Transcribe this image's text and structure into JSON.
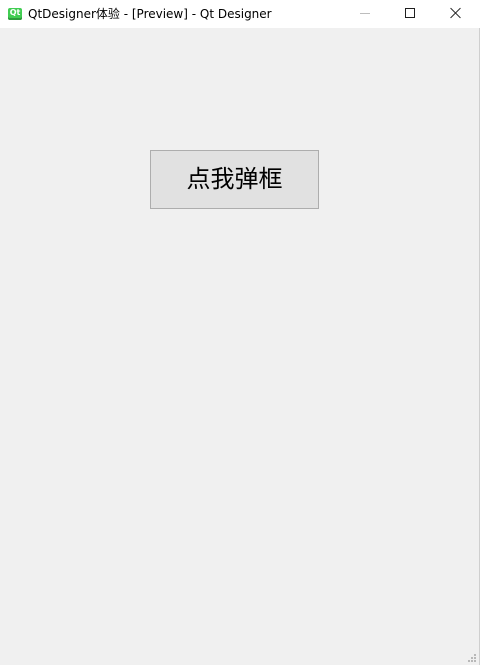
{
  "window": {
    "title": "QtDesigner体验 - [Preview] - Qt Designer",
    "app_icon_text": "Qt",
    "controls": {
      "minimize": "minimize-icon",
      "maximize": "maximize-icon",
      "close": "close-icon"
    }
  },
  "content": {
    "button_label": "点我弹框"
  },
  "colors": {
    "background": "#f0f0f0",
    "titlebar": "#ffffff",
    "button_bg": "#e1e1e1",
    "button_border": "#adadad",
    "qt_green": "#41cd52"
  }
}
